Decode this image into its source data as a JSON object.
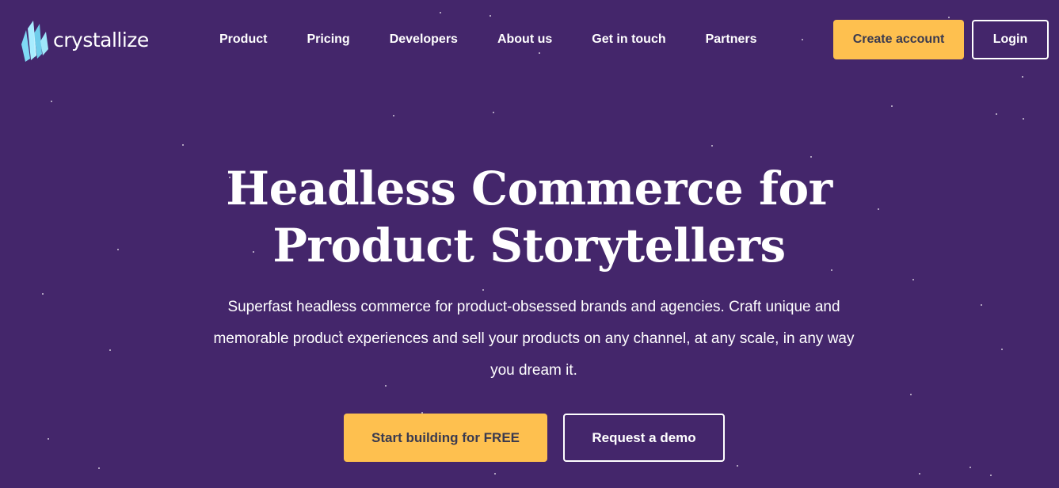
{
  "brand": {
    "name": "crystallize",
    "logo_icon": "crystal-logo-icon"
  },
  "nav": {
    "items": [
      {
        "label": "Product"
      },
      {
        "label": "Pricing"
      },
      {
        "label": "Developers"
      },
      {
        "label": "About us"
      },
      {
        "label": "Get in touch"
      },
      {
        "label": "Partners"
      }
    ]
  },
  "header": {
    "create_account_label": "Create account",
    "login_label": "Login"
  },
  "hero": {
    "title_line1": "Headless Commerce for",
    "title_line2": "Product Storytellers",
    "subtitle": "Superfast headless commerce for product-obsessed brands and agencies. Craft unique and memorable product experiences and sell your products on any channel, at any scale, in any way you dream it.",
    "primary_cta": "Start building for FREE",
    "secondary_cta": "Request a demo"
  },
  "colors": {
    "background": "#44266b",
    "accent": "#fec04f",
    "accent_text": "#3a3a4f",
    "text": "#ffffff"
  }
}
